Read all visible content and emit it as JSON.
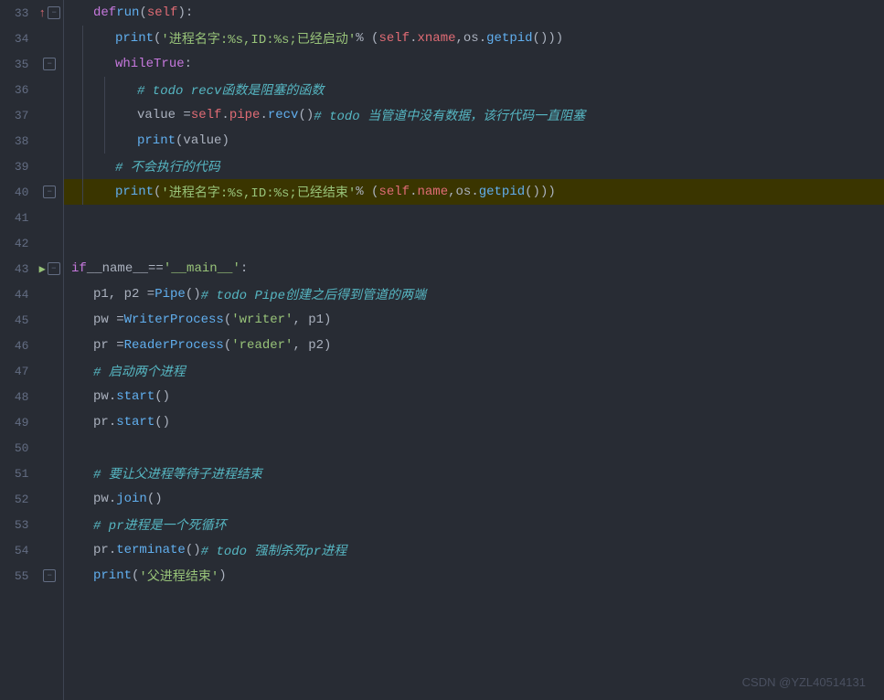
{
  "lines": [
    {
      "num": 33,
      "indent": 1,
      "controls": [
        "up-arrow",
        "fold"
      ],
      "tokens": [
        {
          "t": "kw",
          "v": "def "
        },
        {
          "t": "fn",
          "v": "run"
        },
        {
          "t": "punc",
          "v": "("
        },
        {
          "t": "self-kw",
          "v": "self"
        },
        {
          "t": "punc",
          "v": "):"
        }
      ]
    },
    {
      "num": 34,
      "indent": 2,
      "controls": [],
      "tokens": [
        {
          "t": "fn",
          "v": "print"
        },
        {
          "t": "punc",
          "v": "("
        },
        {
          "t": "str",
          "v": "'进程名字:%s,ID:%s;已经启动'"
        },
        {
          "t": "plain",
          "v": " % ("
        },
        {
          "t": "self-kw",
          "v": "self"
        },
        {
          "t": "punc",
          "v": "."
        },
        {
          "t": "attr",
          "v": "xname"
        },
        {
          "t": "punc",
          "v": ", "
        },
        {
          "t": "plain",
          "v": "os"
        },
        {
          "t": "punc",
          "v": "."
        },
        {
          "t": "fn",
          "v": "getpid"
        },
        {
          "t": "punc",
          "v": "()))"
        }
      ]
    },
    {
      "num": 35,
      "indent": 2,
      "controls": [
        "fold"
      ],
      "tokens": [
        {
          "t": "kw",
          "v": "while "
        },
        {
          "t": "kw",
          "v": "True"
        },
        {
          "t": "punc",
          "v": ":"
        }
      ]
    },
    {
      "num": 36,
      "indent": 3,
      "controls": [],
      "tokens": [
        {
          "t": "cm-todo",
          "v": "# todo recv函数是阻塞的函数"
        }
      ]
    },
    {
      "num": 37,
      "indent": 3,
      "controls": [],
      "tokens": [
        {
          "t": "plain",
          "v": "value = "
        },
        {
          "t": "self-kw",
          "v": "self"
        },
        {
          "t": "punc",
          "v": "."
        },
        {
          "t": "attr",
          "v": "pipe"
        },
        {
          "t": "punc",
          "v": "."
        },
        {
          "t": "fn",
          "v": "recv"
        },
        {
          "t": "punc",
          "v": "()  "
        },
        {
          "t": "cm-todo",
          "v": "# todo 当管道中没有数据，该行代码一直阻塞"
        }
      ]
    },
    {
      "num": 38,
      "indent": 3,
      "controls": [],
      "tokens": [
        {
          "t": "fn",
          "v": "print"
        },
        {
          "t": "punc",
          "v": "("
        },
        {
          "t": "plain",
          "v": "value"
        },
        {
          "t": "punc",
          "v": ")"
        }
      ]
    },
    {
      "num": 39,
      "indent": 2,
      "controls": [],
      "tokens": [
        {
          "t": "cm-zh",
          "v": "# 不会执行的代码"
        }
      ]
    },
    {
      "num": 40,
      "indent": 2,
      "controls": [
        "fold"
      ],
      "highlight": true,
      "tokens": [
        {
          "t": "fn",
          "v": "print"
        },
        {
          "t": "punc",
          "v": "("
        },
        {
          "t": "str",
          "v": "'进程名字:%s,ID:%s;已经结束'"
        },
        {
          "t": "plain",
          "v": " % ("
        },
        {
          "t": "self-kw",
          "v": "self"
        },
        {
          "t": "punc",
          "v": "."
        },
        {
          "t": "attr",
          "v": "name"
        },
        {
          "t": "punc",
          "v": ", "
        },
        {
          "t": "plain",
          "v": "os"
        },
        {
          "t": "punc",
          "v": "."
        },
        {
          "t": "fn",
          "v": "getpid"
        },
        {
          "t": "punc",
          "v": "()))"
        }
      ]
    },
    {
      "num": 41,
      "indent": 0,
      "controls": [],
      "tokens": []
    },
    {
      "num": 42,
      "indent": 0,
      "controls": [],
      "tokens": []
    },
    {
      "num": 43,
      "indent": 0,
      "controls": [
        "run",
        "fold"
      ],
      "tokens": [
        {
          "t": "kw",
          "v": "if "
        },
        {
          "t": "plain",
          "v": "__name__"
        },
        {
          "t": "plain",
          "v": " == "
        },
        {
          "t": "str",
          "v": "'__main__'"
        },
        {
          "t": "punc",
          "v": ":"
        }
      ]
    },
    {
      "num": 44,
      "indent": 1,
      "controls": [],
      "tokens": [
        {
          "t": "plain",
          "v": "p1, p2 = "
        },
        {
          "t": "fn",
          "v": "Pipe"
        },
        {
          "t": "punc",
          "v": "()  "
        },
        {
          "t": "cm-todo",
          "v": "# todo Pipe创建之后得到管道的两端"
        }
      ]
    },
    {
      "num": 45,
      "indent": 1,
      "controls": [],
      "tokens": [
        {
          "t": "plain",
          "v": "pw = "
        },
        {
          "t": "fn",
          "v": "WriterProcess"
        },
        {
          "t": "punc",
          "v": "("
        },
        {
          "t": "str",
          "v": "'writer'"
        },
        {
          "t": "punc",
          "v": ", p1)"
        }
      ]
    },
    {
      "num": 46,
      "indent": 1,
      "controls": [],
      "tokens": [
        {
          "t": "plain",
          "v": "pr = "
        },
        {
          "t": "fn",
          "v": "ReaderProcess"
        },
        {
          "t": "punc",
          "v": "("
        },
        {
          "t": "str",
          "v": "'reader'"
        },
        {
          "t": "punc",
          "v": ", p2)"
        }
      ]
    },
    {
      "num": 47,
      "indent": 1,
      "controls": [],
      "tokens": [
        {
          "t": "cm-zh",
          "v": "# 启动两个进程"
        }
      ]
    },
    {
      "num": 48,
      "indent": 1,
      "controls": [],
      "tokens": [
        {
          "t": "plain",
          "v": "pw"
        },
        {
          "t": "punc",
          "v": "."
        },
        {
          "t": "fn",
          "v": "start"
        },
        {
          "t": "punc",
          "v": "()"
        }
      ]
    },
    {
      "num": 49,
      "indent": 1,
      "controls": [],
      "tokens": [
        {
          "t": "plain",
          "v": "pr"
        },
        {
          "t": "punc",
          "v": "."
        },
        {
          "t": "fn",
          "v": "start"
        },
        {
          "t": "punc",
          "v": "()"
        }
      ]
    },
    {
      "num": 50,
      "indent": 0,
      "controls": [],
      "tokens": []
    },
    {
      "num": 51,
      "indent": 1,
      "controls": [],
      "tokens": [
        {
          "t": "cm-zh",
          "v": "# 要让父进程等待子进程结束"
        }
      ]
    },
    {
      "num": 52,
      "indent": 1,
      "controls": [],
      "tokens": [
        {
          "t": "plain",
          "v": "pw"
        },
        {
          "t": "punc",
          "v": "."
        },
        {
          "t": "fn",
          "v": "join"
        },
        {
          "t": "punc",
          "v": "()"
        }
      ]
    },
    {
      "num": 53,
      "indent": 1,
      "controls": [],
      "tokens": [
        {
          "t": "cm-zh",
          "v": "# pr进程是一个死循环"
        }
      ]
    },
    {
      "num": 54,
      "indent": 1,
      "controls": [],
      "tokens": [
        {
          "t": "plain",
          "v": "pr"
        },
        {
          "t": "punc",
          "v": "."
        },
        {
          "t": "fn",
          "v": "terminate"
        },
        {
          "t": "punc",
          "v": "()  "
        },
        {
          "t": "cm-todo",
          "v": "# todo 强制杀死pr进程"
        }
      ]
    },
    {
      "num": 55,
      "indent": 1,
      "controls": [
        "fold"
      ],
      "tokens": [
        {
          "t": "fn",
          "v": "print"
        },
        {
          "t": "punc",
          "v": "("
        },
        {
          "t": "str",
          "v": "'父进程结束'"
        },
        {
          "t": "punc",
          "v": ")"
        }
      ]
    }
  ],
  "watermark": "CSDN @YZL40514131",
  "indent_sizes": {
    "1": 24,
    "2": 48,
    "3": 72,
    "4": 96
  }
}
